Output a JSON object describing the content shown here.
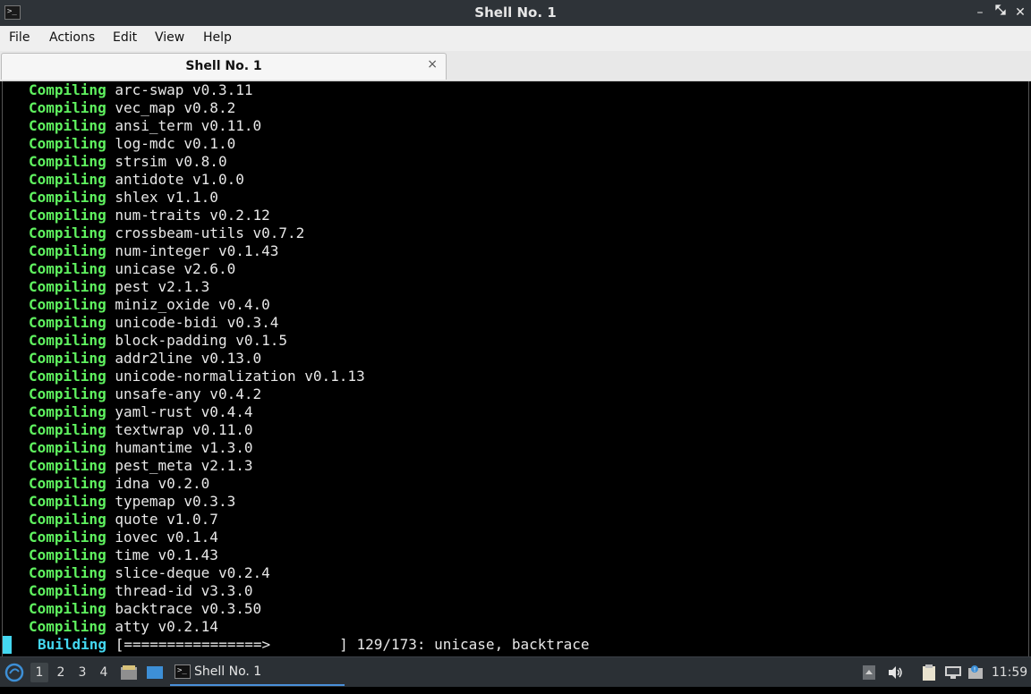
{
  "window": {
    "title": "Shell No. 1",
    "app_icon_glyph": ">_",
    "controls": {
      "minimize": "–",
      "maximize": "⬉",
      "restore": "⬊",
      "close": "✕"
    }
  },
  "menu": [
    "File",
    "Actions",
    "Edit",
    "View",
    "Help"
  ],
  "tabs": [
    {
      "label": "Shell No. 1",
      "close": "×"
    }
  ],
  "terminal": {
    "lines": [
      {
        "status": "Compiling",
        "text": "arc-swap v0.3.11"
      },
      {
        "status": "Compiling",
        "text": "vec_map v0.8.2"
      },
      {
        "status": "Compiling",
        "text": "ansi_term v0.11.0"
      },
      {
        "status": "Compiling",
        "text": "log-mdc v0.1.0"
      },
      {
        "status": "Compiling",
        "text": "strsim v0.8.0"
      },
      {
        "status": "Compiling",
        "text": "antidote v1.0.0"
      },
      {
        "status": "Compiling",
        "text": "shlex v1.1.0"
      },
      {
        "status": "Compiling",
        "text": "num-traits v0.2.12"
      },
      {
        "status": "Compiling",
        "text": "crossbeam-utils v0.7.2"
      },
      {
        "status": "Compiling",
        "text": "num-integer v0.1.43"
      },
      {
        "status": "Compiling",
        "text": "unicase v2.6.0"
      },
      {
        "status": "Compiling",
        "text": "pest v2.1.3"
      },
      {
        "status": "Compiling",
        "text": "miniz_oxide v0.4.0"
      },
      {
        "status": "Compiling",
        "text": "unicode-bidi v0.3.4"
      },
      {
        "status": "Compiling",
        "text": "block-padding v0.1.5"
      },
      {
        "status": "Compiling",
        "text": "addr2line v0.13.0"
      },
      {
        "status": "Compiling",
        "text": "unicode-normalization v0.1.13"
      },
      {
        "status": "Compiling",
        "text": "unsafe-any v0.4.2"
      },
      {
        "status": "Compiling",
        "text": "yaml-rust v0.4.4"
      },
      {
        "status": "Compiling",
        "text": "textwrap v0.11.0"
      },
      {
        "status": "Compiling",
        "text": "humantime v1.3.0"
      },
      {
        "status": "Compiling",
        "text": "pest_meta v2.1.3"
      },
      {
        "status": "Compiling",
        "text": "idna v0.2.0"
      },
      {
        "status": "Compiling",
        "text": "typemap v0.3.3"
      },
      {
        "status": "Compiling",
        "text": "quote v1.0.7"
      },
      {
        "status": "Compiling",
        "text": "iovec v0.1.4"
      },
      {
        "status": "Compiling",
        "text": "time v0.1.43"
      },
      {
        "status": "Compiling",
        "text": "slice-deque v0.2.4"
      },
      {
        "status": "Compiling",
        "text": "thread-id v3.3.0"
      },
      {
        "status": "Compiling",
        "text": "backtrace v0.3.50"
      },
      {
        "status": "Compiling",
        "text": "atty v0.2.14"
      }
    ],
    "progress_line": {
      "status": "Building",
      "bar": "[================>        ]",
      "text": "129/173: unicase, backtrace"
    },
    "colors": {
      "compiling": "#5ff25f",
      "building": "#44d7f0",
      "text": "#e8e8e8",
      "background": "#000000"
    }
  },
  "taskbar": {
    "workspaces": [
      "1",
      "2",
      "3",
      "4"
    ],
    "active_workspace": "1",
    "task": {
      "label": "Shell No. 1",
      "icon_glyph": ">_"
    },
    "clock": "11:59",
    "tray_icons": [
      "up-arrow-icon",
      "volume-icon",
      "clipboard-icon",
      "network-icon",
      "notification-icon"
    ]
  }
}
